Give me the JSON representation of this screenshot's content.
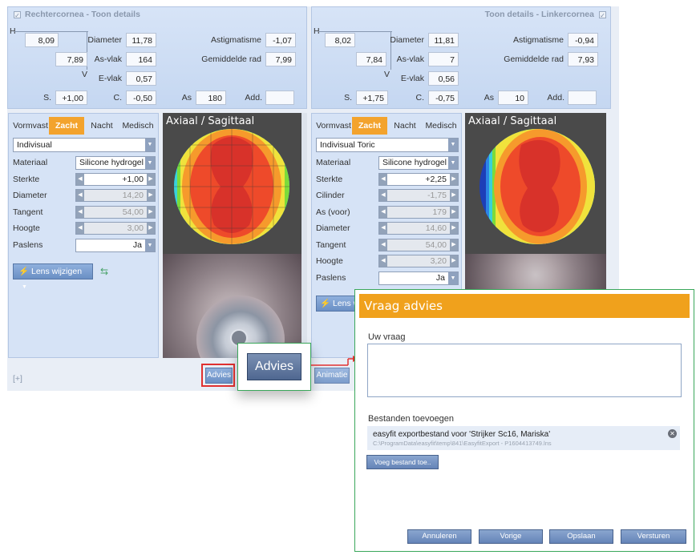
{
  "right_eye": {
    "title": "Rechtercornea",
    "subtitle": "Toon details",
    "h_label": "H",
    "h_value": "8,09",
    "v_value": "7,89",
    "v_label": "V",
    "diameter_label": "Diameter",
    "diameter": "11,78",
    "asvlak_label": "As-vlak",
    "asvlak": "164",
    "evlak_label": "E-vlak",
    "evlak": "0,57",
    "astig_label": "Astigmatisme",
    "astig": "-1,07",
    "gemrad_label": "Gemiddelde rad",
    "gemrad": "7,99",
    "s_label": "S.",
    "s": "+1,00",
    "c_label": "C.",
    "c": "-0,50",
    "as_label": "As",
    "as": "180",
    "add_label": "Add.",
    "add": ""
  },
  "left_eye": {
    "title": "Linkercornea",
    "subtitle": "Toon details",
    "h_label": "H",
    "h_value": "8,02",
    "v_value": "7,84",
    "v_label": "V",
    "diameter_label": "Diameter",
    "diameter": "11,81",
    "asvlak_label": "As-vlak",
    "asvlak": "7",
    "evlak_label": "E-vlak",
    "evlak": "0,56",
    "astig_label": "Astigmatisme",
    "astig": "-0,94",
    "gemrad_label": "Gemiddelde rad",
    "gemrad": "7,93",
    "s_label": "S.",
    "s": "+1,75",
    "c_label": "C.",
    "c": "-0,75",
    "as_label": "As",
    "as": "10",
    "add_label": "Add.",
    "add": ""
  },
  "tabs": [
    "Vormvast",
    "Zacht",
    "Nacht",
    "Medisch"
  ],
  "active_tab": "Zacht",
  "right_lens": {
    "type": "Indivisual",
    "rows": [
      {
        "label": "Materiaal",
        "value": "Silicone hydrogel"
      },
      {
        "label": "Sterkte",
        "value": "+1,00"
      },
      {
        "label": "Diameter",
        "value": "14,20"
      },
      {
        "label": "Tangent",
        "value": "54,00"
      },
      {
        "label": "Hoogte",
        "value": "3,00"
      },
      {
        "label": "Paslens",
        "value": "Ja"
      }
    ],
    "change_button": "Lens wijzigen"
  },
  "left_lens": {
    "type": "Indivisual Toric",
    "rows": [
      {
        "label": "Materiaal",
        "value": "Silicone hydrogel"
      },
      {
        "label": "Sterkte",
        "value": "+2,25"
      },
      {
        "label": "Cilinder",
        "value": "-1,75"
      },
      {
        "label": "As (voor)",
        "value": "179"
      },
      {
        "label": "Diameter",
        "value": "14,60"
      },
      {
        "label": "Tangent",
        "value": "54,00"
      },
      {
        "label": "Hoogte",
        "value": "3,20"
      },
      {
        "label": "Paslens",
        "value": "Ja"
      }
    ],
    "change_button": "Lens wi"
  },
  "map_title": "Axiaal / Sagittaal",
  "expand_label": "[+]",
  "advies_button": "Advies",
  "advies_zoom": "Advies",
  "animatie_button": "Animatie",
  "dialog": {
    "title": "Vraag advies",
    "question_label": "Uw vraag",
    "question_value": "",
    "files_label": "Bestanden toevoegen",
    "file_name": "easyfit exportbestand voor 'Strijker Sc16, Mariska'",
    "file_path": "C:\\ProgramData\\easyfit\\temp\\841\\EasyfitExport - P1604413749.lns",
    "add_file_button": "Voeg bestand toe..",
    "buttons": [
      "Annuleren",
      "Vorige",
      "Opslaan",
      "Versturen"
    ]
  },
  "colors": {
    "accent_orange": "#f0a11c",
    "panel_blue": "#c9dbf3",
    "dialog_border": "#3aa75a",
    "highlight_red": "#e03030"
  }
}
